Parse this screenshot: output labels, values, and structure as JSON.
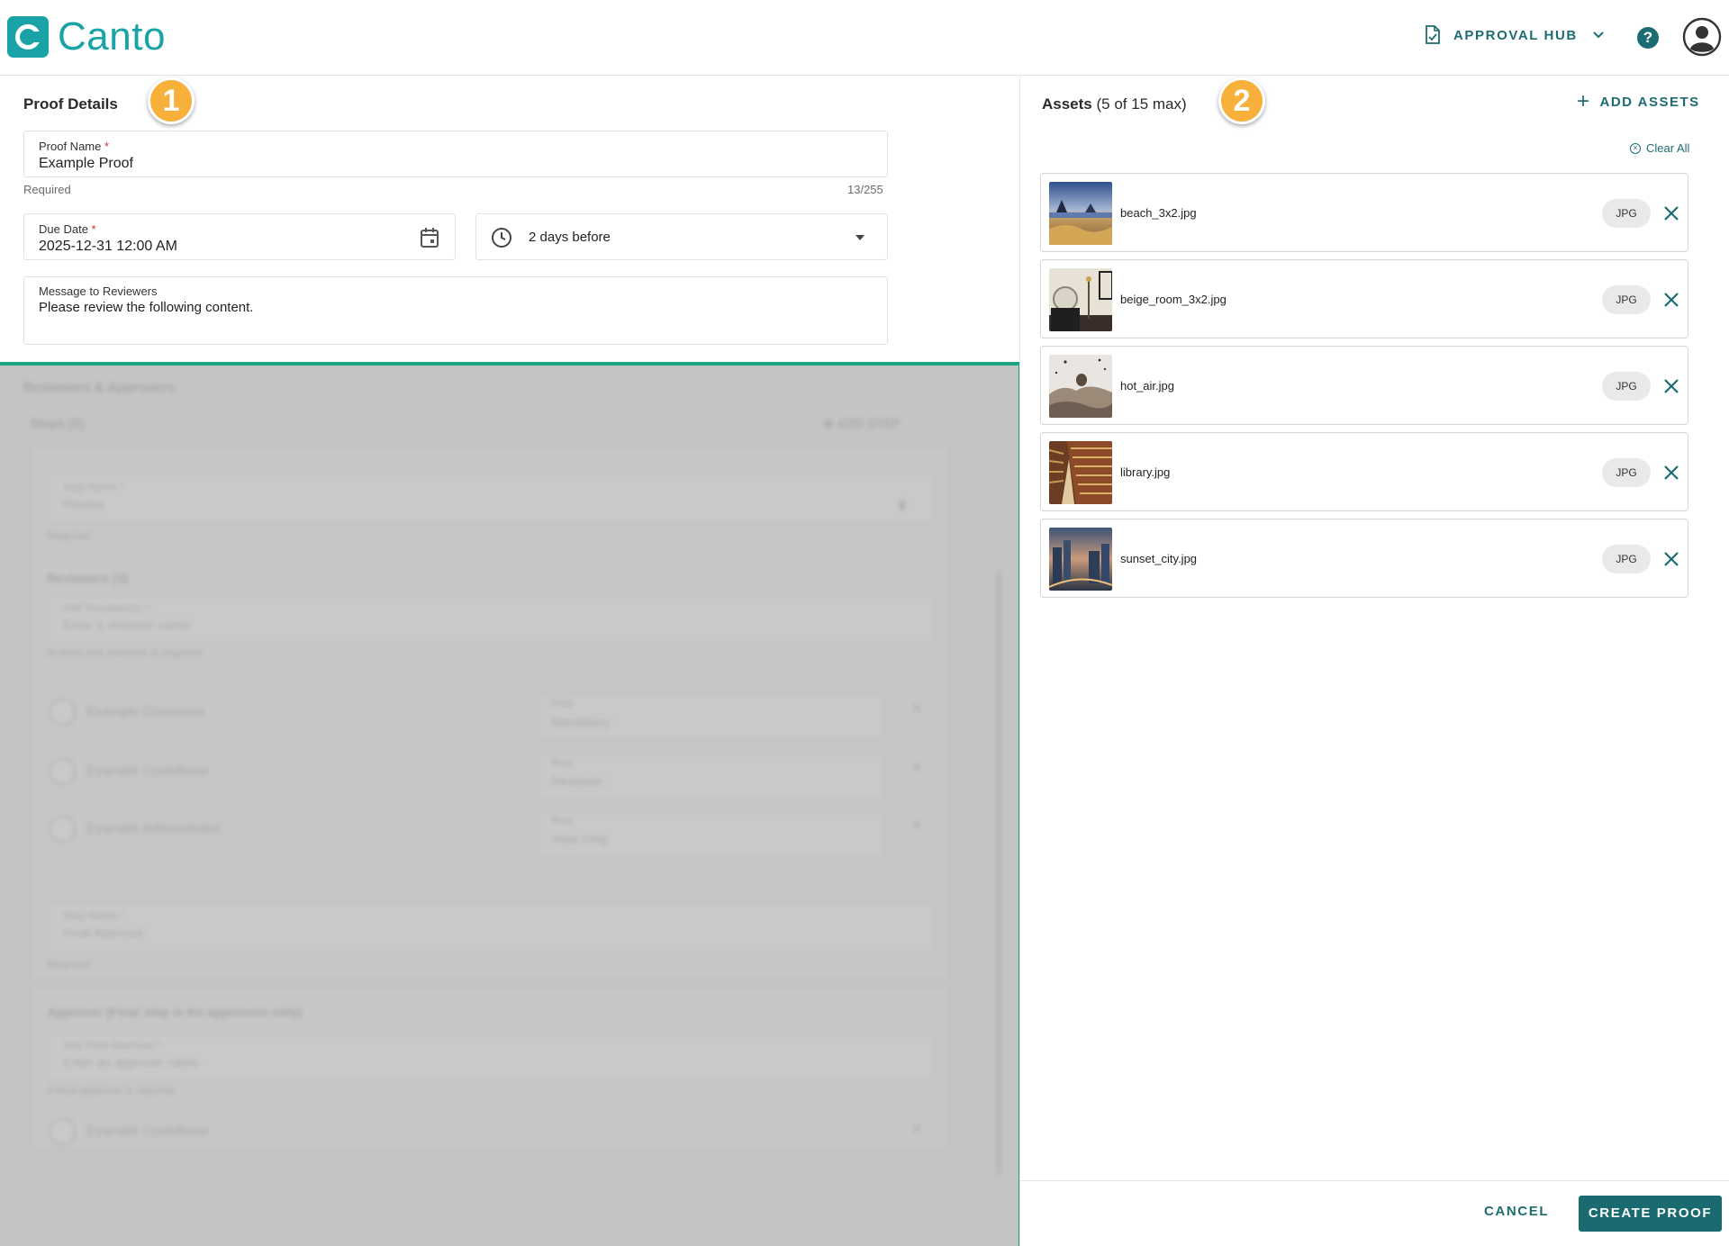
{
  "header": {
    "logo_text": "Canto",
    "hub_label": "APPROVAL HUB",
    "help_glyph": "?",
    "brand_color": "#1aa3a6",
    "accent_color": "#1c6c72"
  },
  "proof_details": {
    "title": "Proof Details",
    "badge": "1",
    "proof_name": {
      "label": "Proof Name",
      "required_mark": "*",
      "value": "Example Proof",
      "hint": "Required",
      "counter": "13/255"
    },
    "due_date": {
      "label": "Due Date",
      "required_mark": "*",
      "value": "2025-12-31 12:00 AM"
    },
    "reminder": {
      "value": "2 days before"
    },
    "message": {
      "label": "Message to Reviewers",
      "value": "Please review the following content."
    }
  },
  "blurred": {
    "section_title": "Reviewers & Approvers",
    "steps": "Steps (2)",
    "add_step": "ADD STEP",
    "step1_label": "Step Name *",
    "step1_value": "Review",
    "step1_hint": "Required",
    "reviewers_title": "Reviewers (3)",
    "add_reviewers_label": "Add Reviewer(s) *",
    "add_reviewers_placeholder": "Enter a reviewer name",
    "reviewers_hint": "At least one reviewer is required",
    "reviewers": [
      {
        "name": "Example Consumer",
        "role_label": "Role",
        "role": "Mandatory"
      },
      {
        "name": "Example Contributor",
        "role_label": "Role",
        "role": "Reviewer"
      },
      {
        "name": "Example Administrator",
        "role_label": "Role",
        "role": "View Only"
      }
    ],
    "step2_label": "Step Name *",
    "step2_value": "Final Approval",
    "step2_hint": "Required",
    "approver_title": "Approver (Final step is for approvers only)",
    "add_approver_label": "Add Final Approver *",
    "add_approver_placeholder": "Enter an approver name",
    "approver_hint": "A final approver is required",
    "approver_name": "Example Contributor"
  },
  "assets": {
    "title": "Assets",
    "count_text": "(5 of 15 max)",
    "badge": "2",
    "add_label": "ADD ASSETS",
    "clear_label": "Clear All",
    "items": [
      {
        "name": "beach_3x2.jpg",
        "type": "JPG",
        "thumb": "beach"
      },
      {
        "name": "beige_room_3x2.jpg",
        "type": "JPG",
        "thumb": "room"
      },
      {
        "name": "hot_air.jpg",
        "type": "JPG",
        "thumb": "balloon"
      },
      {
        "name": "library.jpg",
        "type": "JPG",
        "thumb": "library"
      },
      {
        "name": "sunset_city.jpg",
        "type": "JPG",
        "thumb": "city"
      }
    ]
  },
  "footer": {
    "cancel_label": "CANCEL",
    "create_label": "CREATE PROOF"
  }
}
